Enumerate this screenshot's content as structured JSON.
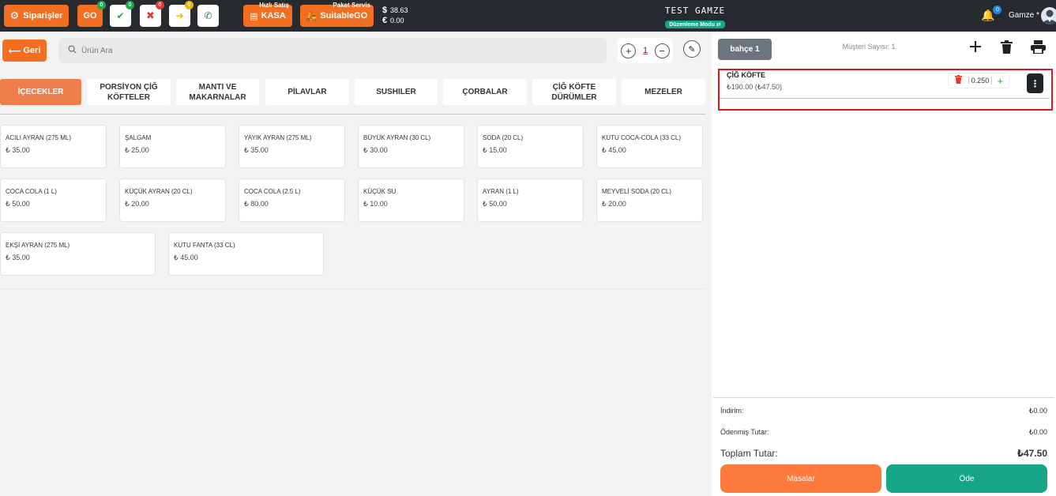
{
  "topbar": {
    "orders_label": "Siparişler",
    "go_label": "GO",
    "go_count": "0",
    "check_count": "0",
    "cancel_count": "0",
    "forward_count": "0",
    "kasa_tag": "Hızlı Satış",
    "kasa_label": "KASA",
    "delivery_tag": "Paket Servis",
    "delivery_label": "SuitableGO",
    "usd_symbol": "$",
    "usd_rate": "38.63",
    "eur_symbol": "€",
    "eur_rate": "0.00",
    "store_name": "TEST GAMZE",
    "mode_label": "Düzenleme Modu",
    "notification_count": "0",
    "user_name": "Gamze"
  },
  "toolbar": {
    "back_label": "Geri",
    "search_placeholder": "Ürün Ara",
    "quantity": "1"
  },
  "categories": [
    {
      "label": "İÇECEKLER"
    },
    {
      "label": "PORSİYON ÇİĞ KÖFTELER"
    },
    {
      "label": "MANTI VE MAKARNALAR"
    },
    {
      "label": "PİLAVLAR"
    },
    {
      "label": "SUSHILER"
    },
    {
      "label": "ÇORBALAR"
    },
    {
      "label": "ÇİĞ KÖFTE DÜRÜMLER"
    },
    {
      "label": "MEZELER"
    }
  ],
  "products": [
    {
      "name": "ACILI AYRAN (275 ML)",
      "price": "₺ 35.00"
    },
    {
      "name": "ŞALGAM",
      "price": "₺ 25.00"
    },
    {
      "name": "YAYIK AYRAN (275 ML)",
      "price": "₺ 35.00"
    },
    {
      "name": "BÜYÜK AYRAN (30 CL)",
      "price": "₺ 30.00"
    },
    {
      "name": "SODA (20 CL)",
      "price": "₺ 15.00"
    },
    {
      "name": "KUTU COCA-COLA (33 CL)",
      "price": "₺ 45.00"
    },
    {
      "name": "COCA COLA (1 L)",
      "price": "₺ 50.00"
    },
    {
      "name": "KÜÇÜK AYRAN (20 CL)",
      "price": "₺ 20.00"
    },
    {
      "name": "COCA COLA (2.5 L)",
      "price": "₺ 80.00"
    },
    {
      "name": "KÜÇÜK SU",
      "price": "₺ 10.00"
    },
    {
      "name": "AYRAN (1 L)",
      "price": "₺ 50.00"
    },
    {
      "name": "MEYVELİ SODA (20 CL)",
      "price": "₺ 20.00"
    },
    {
      "name": "EKŞİ AYRAN (275 ML)",
      "price": "₺ 35.00"
    },
    {
      "name": "KUTU FANTA (33 CL)",
      "price": "₺ 45.00"
    }
  ],
  "order": {
    "table_label": "bahçe 1",
    "customer_count_label": "Müşteri Sayısı: 1",
    "items": [
      {
        "name": "ÇİĞ KÖFTE",
        "price": "₺190.00 (₺47.50)",
        "quantity": "0.250"
      }
    ],
    "discount_label": "İndirim:",
    "discount_value": "₺0.00",
    "paid_label": "Ödenmiş Tutar:",
    "paid_value": "₺0.00",
    "total_label": "Toplam Tutar:",
    "total_value": "₺47.50",
    "tables_button": "Masalar",
    "pay_button": "Öde"
  },
  "colors": {
    "accent": "#f26f21",
    "topbar": "#272b30",
    "pay": "#17a589",
    "selection_border": "#e0161c"
  }
}
